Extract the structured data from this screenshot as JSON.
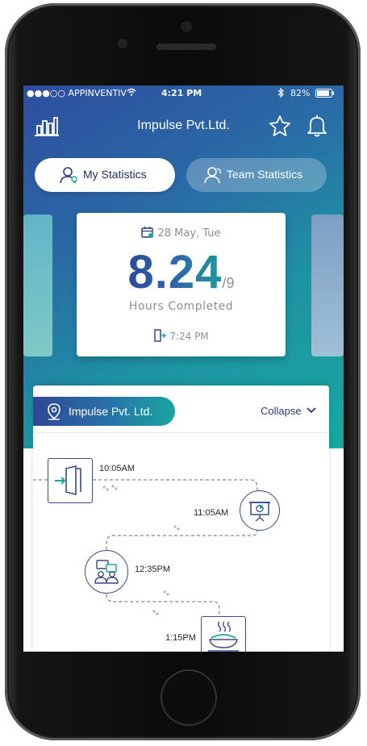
{
  "status_bar": {
    "carrier": "●●●○○ APPINVENTIV",
    "time": "4:21 PM",
    "battery": "82%"
  },
  "header": {
    "title": "Impulse Pvt.Ltd.",
    "left_icon": "bar-chart-icon",
    "right_icons": [
      "star-icon",
      "bell-icon"
    ]
  },
  "tabs": [
    {
      "label": "My Statistics",
      "active": true,
      "icon": "user-icon"
    },
    {
      "label": "Team Statistics",
      "active": false,
      "icon": "team-icon"
    }
  ],
  "day_card": {
    "date": "28 May, Tue",
    "hours_done": "8.24",
    "hours_total": "/9",
    "caption": "Hours Completed",
    "checkout_time": "7:24 PM"
  },
  "timeline": {
    "company": "Impulse Pvt. Ltd.",
    "collapse_label": "Collapse",
    "events": [
      {
        "time": "10:05AM",
        "icon": "check-in-door-icon"
      },
      {
        "time": "11:05AM",
        "icon": "presentation-icon"
      },
      {
        "time": "12:35PM",
        "icon": "meeting-icon"
      },
      {
        "time": "1:15PM",
        "icon": "lunch-icon"
      }
    ]
  },
  "colors": {
    "gradient_start": "#2e4d9e",
    "gradient_end": "#17a8a0",
    "primary_dark": "#2b3a7a",
    "muted_text": "#8a8f9c"
  }
}
